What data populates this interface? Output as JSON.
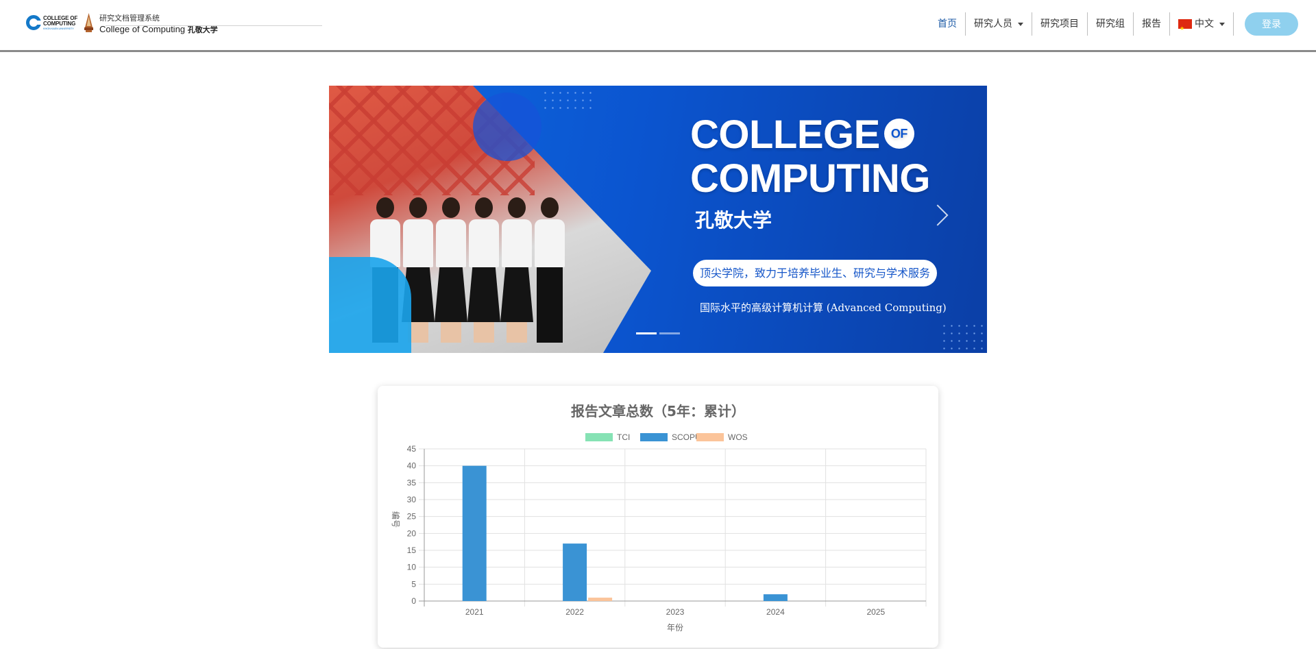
{
  "header": {
    "logo_cc_line1": "COLLEGE OF",
    "logo_cc_line2": "COMPUTING",
    "logo_cc_sub": "KHON KAEN UNIVERSITY",
    "system_name": "研究文档管理系统",
    "college_name": "College of Computing",
    "university_name": "孔敬大学"
  },
  "nav": {
    "items": [
      {
        "label": "首页",
        "active": true
      },
      {
        "label": "研究人员",
        "dropdown": true
      },
      {
        "label": "研究项目"
      },
      {
        "label": "研究组"
      },
      {
        "label": "报告"
      }
    ],
    "language": "中文",
    "login_label": "登录"
  },
  "banner": {
    "title_line1": "COLLEGE",
    "title_of": "OF",
    "title_line2": "COMPUTING",
    "title_cn": "孔敬大学",
    "pill_text": "顶尖学院，致力于培养毕业生、研究与学术服务",
    "subtitle": "国际水平的高级计算机计算 (Advanced Computing)",
    "slide_count": 2,
    "active_slide": 0
  },
  "colors": {
    "tci": "#86e2b4",
    "scopus": "#3a93d4",
    "wos": "#fbc49a",
    "nav_active": "#1c5aa6",
    "login_bg": "#8fd0ee"
  },
  "chart_data": {
    "type": "bar",
    "title": "报告文章总数（5年：累计）",
    "xlabel": "年份",
    "ylabel": "编号",
    "ylim": [
      0,
      45
    ],
    "yticks": [
      0,
      5,
      10,
      15,
      20,
      25,
      30,
      35,
      40,
      45
    ],
    "categories": [
      "2021",
      "2022",
      "2023",
      "2024",
      "2025"
    ],
    "series": [
      {
        "name": "TCI",
        "values": [
          0,
          0,
          0,
          0,
          0
        ]
      },
      {
        "name": "SCOPUS",
        "values": [
          40,
          17,
          0,
          2,
          0
        ]
      },
      {
        "name": "WOS",
        "values": [
          0,
          1,
          0,
          0,
          0
        ]
      }
    ],
    "legend_position": "top",
    "grid": true
  }
}
